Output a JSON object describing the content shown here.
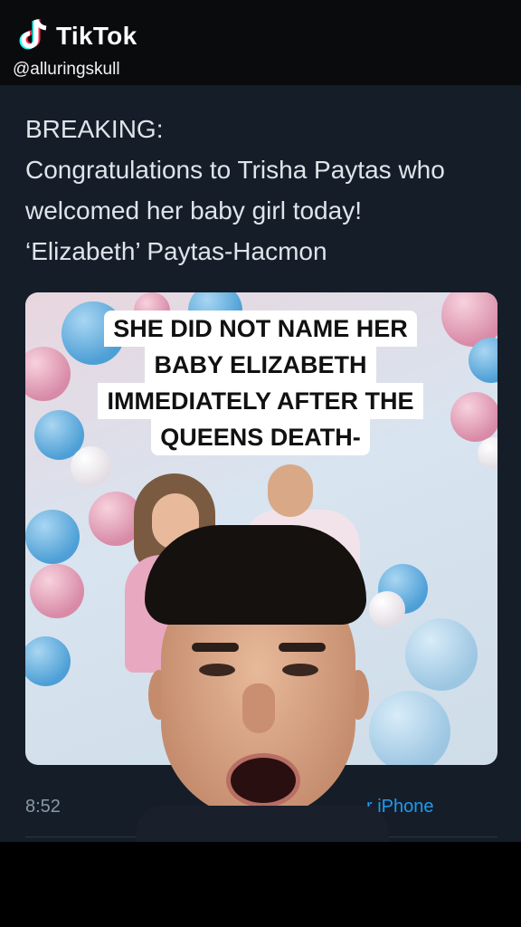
{
  "tiktok": {
    "brand": "TikTok",
    "handle": "@alluringskull",
    "logo_icon": "tiktok-note-icon"
  },
  "tweet": {
    "lines": [
      "BREAKING:",
      "Congratulations to Trisha Paytas who",
      "welcomed her baby girl today!",
      "‘Elizabeth’ Paytas-Hacmon"
    ],
    "time_partial": "8:52",
    "source_partial": "r iPhone"
  },
  "caption": {
    "lines": [
      "SHE DID NOT NAME HER",
      "BABY ELIZABETH",
      "IMMEDIATELY AFTER THE",
      "QUEENS DEATH-"
    ]
  },
  "colors": {
    "tweet_background": "#151d29",
    "link_blue": "#1d9bf0",
    "caption_background": "#ffffff"
  }
}
